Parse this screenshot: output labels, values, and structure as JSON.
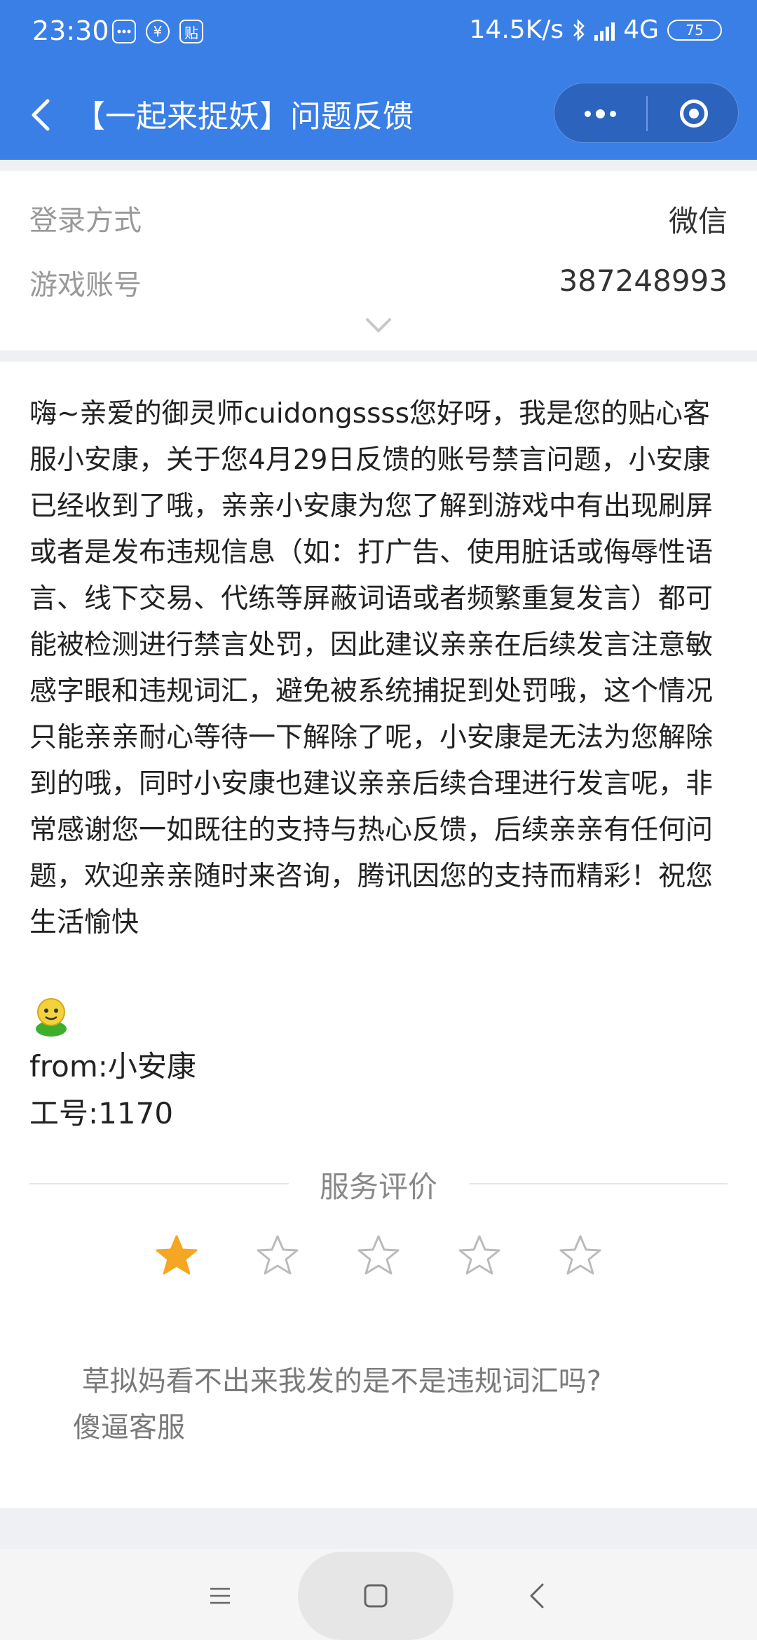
{
  "status_bar": {
    "time": "23:30",
    "notification_icons": [
      "message-icon",
      "yuan-icon",
      "tie-icon"
    ],
    "net_speed": "14.5K/s",
    "network": "4G",
    "battery": "75"
  },
  "header": {
    "title": "【一起来捉妖】问题反馈",
    "actions": [
      "more-icon",
      "close-icon"
    ]
  },
  "info": {
    "rows": [
      {
        "label": "登录方式",
        "value": "微信"
      },
      {
        "label": "游戏账号",
        "value": "387248993"
      }
    ]
  },
  "message": {
    "body": "嗨~亲爱的御灵师cuidongssss您好呀，我是您的贴心客服小安康，关于您4月29日反馈的账号禁言问题，小安康已经收到了哦，亲亲小安康为您了解到游戏中有出现刷屏或者是发布违规信息（如：打广告、使用脏话或侮辱性语言、线下交易、代练等屏蔽词语或者频繁重复发言）都可能被检测进行禁言处罚，因此建议亲亲在后续发言注意敏感字眼和违规词汇，避免被系统捕捉到处罚哦，这个情况只能亲亲耐心等待一下解除了呢，小安康是无法为您解除到的哦，同时小安康也建议亲亲后续合理进行发言呢，非常感谢您一如既往的支持与热心反馈，后续亲亲有任何问题，欢迎亲亲随时来咨询，腾讯因您的支持而精彩！祝您生活愉快",
    "from": "from:小安康",
    "staff_id": "工号:1170"
  },
  "rating": {
    "title": "服务评价",
    "stars_selected": 1,
    "stars_total": 5,
    "active_color": "#f5a623",
    "inactive_color": "#bbbbbb"
  },
  "comment": {
    "text": " 草拟妈看不出来我发的是不是违规词汇吗?\n傻逼客服"
  },
  "navbar": {
    "buttons": [
      "menu-icon",
      "home-icon",
      "back-icon"
    ]
  },
  "theme": {
    "primary": "#3a7fe6"
  }
}
